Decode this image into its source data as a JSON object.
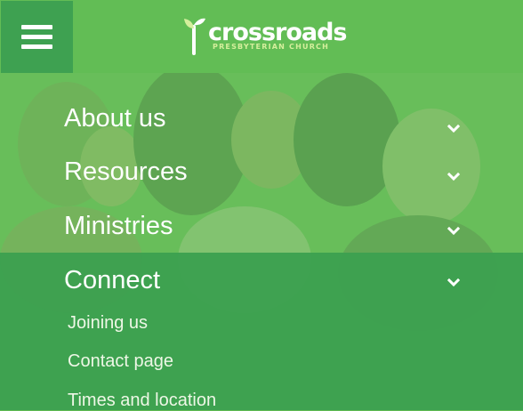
{
  "header": {
    "menu_icon": "hamburger-icon",
    "logo": {
      "name": "crossroads",
      "subtitle": "PRESBYTERIAN CHURCH",
      "mark_icon": "sprout-cross-icon"
    }
  },
  "nav": {
    "items": [
      {
        "label": "About us"
      },
      {
        "label": "Resources"
      },
      {
        "label": "Ministries"
      },
      {
        "label": "Connect",
        "expanded": true
      }
    ],
    "connect_subitems": [
      {
        "label": "Joining us"
      },
      {
        "label": "Contact page"
      },
      {
        "label": "Times and location"
      }
    ]
  },
  "colors": {
    "header_bg": "#62bd55",
    "menu_button_bg": "#3ea151",
    "overlay_green": "#66be58",
    "connect_panel_bg": "#3ca050",
    "logo_subtitle": "#d5ef9c"
  }
}
